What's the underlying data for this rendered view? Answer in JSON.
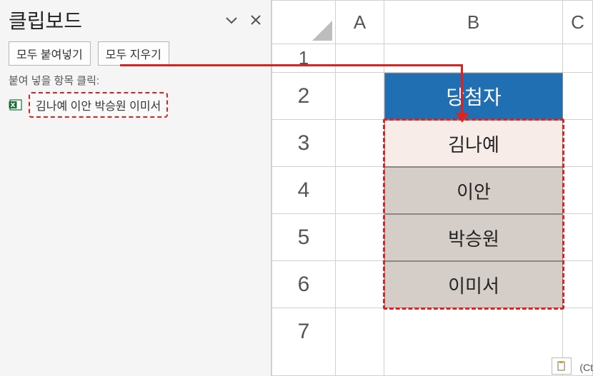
{
  "pane": {
    "title": "클립보드",
    "paste_all_label": "모두 붙여넣기",
    "clear_all_label": "모두 지우기",
    "hint": "붙여 넣을 항목 클릭:",
    "item_text": "김나예 이안 박승원 이미서"
  },
  "sheet": {
    "cols": {
      "a": "A",
      "b": "B",
      "c": "C"
    },
    "rows": {
      "r1": "1",
      "r2": "2",
      "r3": "3",
      "r4": "4",
      "r5": "5",
      "r6": "6",
      "r7": "7"
    },
    "header_label": "당첨자",
    "data": [
      "김나예",
      "이안",
      "박승원",
      "이미서"
    ]
  },
  "paste_options_hint": "(Ct"
}
